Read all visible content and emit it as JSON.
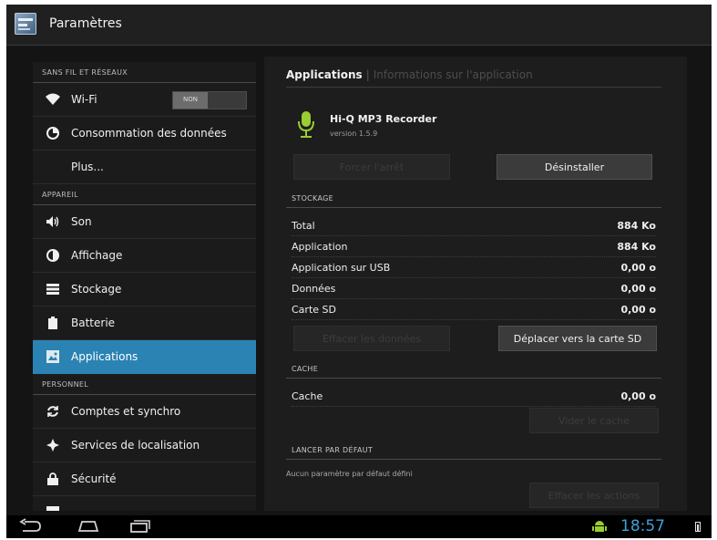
{
  "header": {
    "title": "Paramètres"
  },
  "sidebar": {
    "sections": [
      {
        "label": "SANS FIL ET RÉSEAUX"
      },
      {
        "label": "APPAREIL"
      },
      {
        "label": "PERSONNEL"
      }
    ],
    "items": [
      {
        "label": "Wi-Fi",
        "icon": "wifi-icon"
      },
      {
        "label": "Consommation des données",
        "icon": "data-usage-icon"
      },
      {
        "label": "Plus..."
      },
      {
        "label": "Son",
        "icon": "speaker-icon"
      },
      {
        "label": "Affichage",
        "icon": "brightness-icon"
      },
      {
        "label": "Stockage",
        "icon": "storage-icon"
      },
      {
        "label": "Batterie",
        "icon": "battery-icon"
      },
      {
        "label": "Applications",
        "icon": "applications-icon",
        "selected": true
      },
      {
        "label": "Comptes et synchro",
        "icon": "sync-icon"
      },
      {
        "label": "Services de localisation",
        "icon": "location-icon"
      },
      {
        "label": "Sécurité",
        "icon": "lock-icon"
      }
    ],
    "wifi_toggle": "NON"
  },
  "main": {
    "tabs": [
      {
        "label": "Applications",
        "active": true
      },
      {
        "label": "Informations sur l'application",
        "active": false
      }
    ],
    "app": {
      "name": "Hi-Q MP3 Recorder",
      "version": "version 1.5.9"
    },
    "buttons": {
      "force_stop": "Forcer l'arrêt",
      "uninstall": "Désinstaller",
      "clear_data": "Effacer les données",
      "move_sd": "Déplacer vers la carte SD",
      "clear_cache": "Vider le cache",
      "clear_defaults": "Effacer les actions"
    },
    "storage": {
      "header": "STOCKAGE",
      "rows": [
        {
          "label": "Total",
          "value": "884 Ko"
        },
        {
          "label": "Application",
          "value": "884 Ko"
        },
        {
          "label": "Application sur USB",
          "value": "0,00 o"
        },
        {
          "label": "Données",
          "value": "0,00 o"
        },
        {
          "label": "Carte SD",
          "value": "0,00 o"
        }
      ]
    },
    "cache": {
      "header": "CACHE",
      "label": "Cache",
      "value": "0,00 o"
    },
    "defaults": {
      "header": "LANCER PAR DÉFAUT",
      "text": "Aucun paramètre par défaut défini"
    }
  },
  "statusbar": {
    "time": "18:57"
  },
  "colors": {
    "accent": "#2b83b3",
    "clock": "#3ba2d8",
    "app_icon": "#9acd32"
  }
}
